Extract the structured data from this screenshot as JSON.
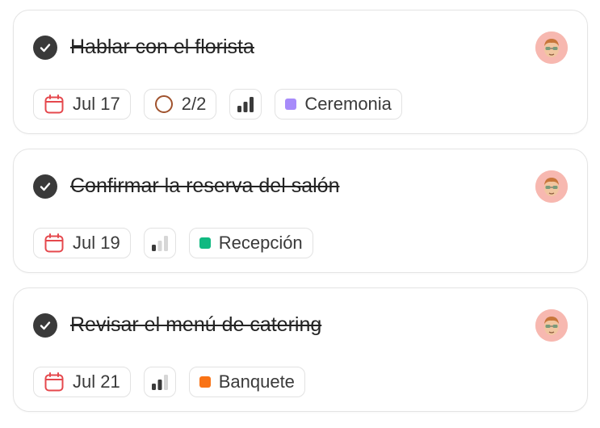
{
  "tasks": [
    {
      "title": "Hablar con el florista",
      "date": "Jul 17",
      "subtasks": "2/2",
      "priority": "high",
      "tag": {
        "label": "Ceremonia",
        "color": "#a78bfa"
      }
    },
    {
      "title": "Confirmar la reserva del salón",
      "date": "Jul 19",
      "priority": "low",
      "tag": {
        "label": "Recepción",
        "color": "#10b981"
      }
    },
    {
      "title": "Revisar el menú de catering",
      "date": "Jul 21",
      "priority": "medium",
      "tag": {
        "label": "Banquete",
        "color": "#f97316"
      }
    }
  ]
}
